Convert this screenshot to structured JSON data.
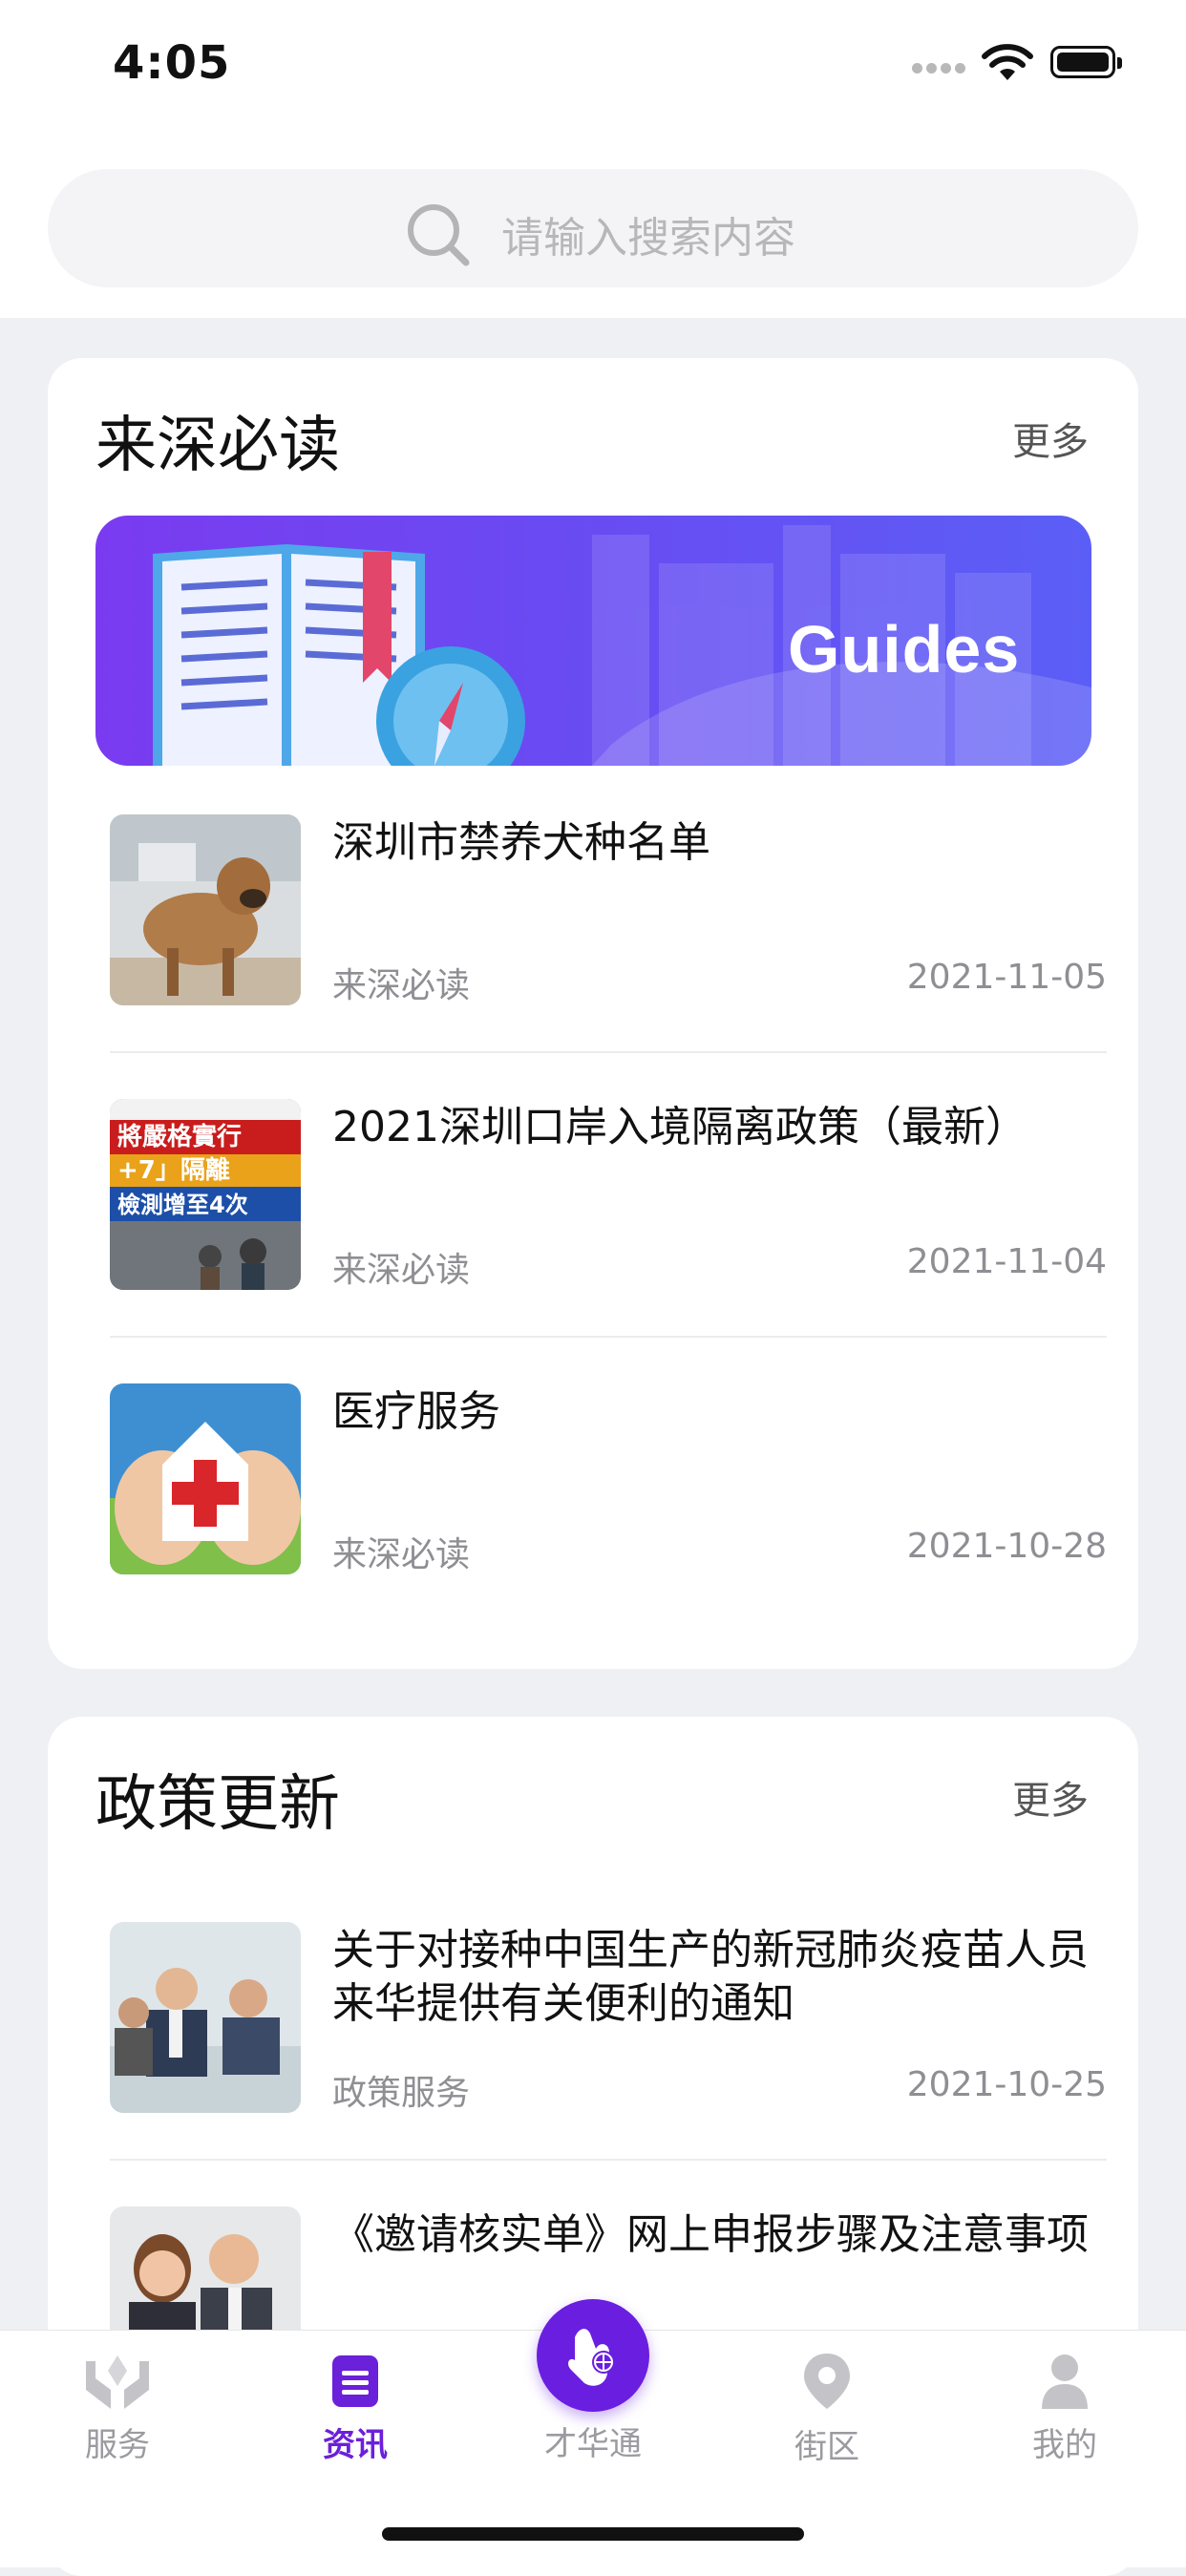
{
  "status_bar": {
    "time": "4:05"
  },
  "search": {
    "placeholder": "请输入搜索内容"
  },
  "section_must_read": {
    "title": "来深必读",
    "more": "更多",
    "banner_text": "Guides",
    "items": [
      {
        "title": "深圳市禁养犬种名单",
        "category": "来深必读",
        "date": "2021-11-05",
        "thumb": "dog-photo"
      },
      {
        "title": "2021深圳口岸入境隔离政策（最新）",
        "category": "来深必读",
        "date": "2021-11-04",
        "thumb": "quarantine-news-photo"
      },
      {
        "title": "医疗服务",
        "category": "来深必读",
        "date": "2021-10-28",
        "thumb": "medical-house-hands-photo"
      }
    ]
  },
  "section_policy": {
    "title": "政策更新",
    "more": "更多",
    "items": [
      {
        "title": "关于对接种中国生产的新冠肺炎疫苗人员来华提供有关便利的通知",
        "category": "政策服务",
        "date": "2021-10-25",
        "thumb": "business-meeting-photo"
      },
      {
        "title": "《邀请核实单》网上申报步骤及注意事项",
        "thumb": "business-people-photo"
      }
    ]
  },
  "tabbar": {
    "tabs": [
      {
        "label": "服务",
        "icon": "hands-service-icon",
        "active": false
      },
      {
        "label": "资讯",
        "icon": "news-doc-icon",
        "active": true
      },
      {
        "label": "才华通",
        "icon": "ok-hand-globe-icon",
        "active": false
      },
      {
        "label": "街区",
        "icon": "map-pin-icon",
        "active": false
      },
      {
        "label": "我的",
        "icon": "person-icon",
        "active": false
      }
    ],
    "accent": "#6a1ee0"
  }
}
